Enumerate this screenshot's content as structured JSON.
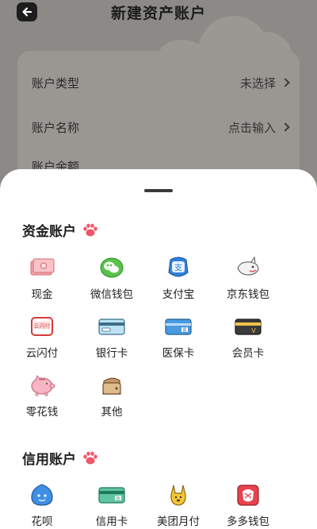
{
  "header": {
    "title": "新建资产账户"
  },
  "form": {
    "rows": [
      {
        "label": "账户类型",
        "value": "未选择"
      },
      {
        "label": "账户名称",
        "value": "点击输入"
      },
      {
        "label": "账户余额",
        "value": ""
      }
    ]
  },
  "sheet": {
    "sections": [
      {
        "title": "资金账户",
        "items": [
          {
            "label": "现金",
            "icon": "cash-icon"
          },
          {
            "label": "微信钱包",
            "icon": "wechat-wallet-icon"
          },
          {
            "label": "支付宝",
            "icon": "alipay-icon"
          },
          {
            "label": "京东钱包",
            "icon": "jd-wallet-icon"
          },
          {
            "label": "云闪付",
            "icon": "unionpay-quickpass-icon"
          },
          {
            "label": "银行卡",
            "icon": "bank-card-icon"
          },
          {
            "label": "医保卡",
            "icon": "medical-card-icon"
          },
          {
            "label": "会员卡",
            "icon": "member-card-icon"
          },
          {
            "label": "零花钱",
            "icon": "piggy-bank-icon"
          },
          {
            "label": "其他",
            "icon": "other-wallet-icon"
          }
        ]
      },
      {
        "title": "信用账户",
        "items": [
          {
            "label": "花呗",
            "icon": "huabei-icon"
          },
          {
            "label": "信用卡",
            "icon": "credit-card-icon"
          },
          {
            "label": "美团月付",
            "icon": "meituan-pay-icon"
          },
          {
            "label": "多多钱包",
            "icon": "duoduo-wallet-icon"
          }
        ]
      }
    ]
  },
  "colors": {
    "sheet_bg": "#ffffff",
    "overlay_bg": "#8c8a86",
    "paw": "#f0566a"
  }
}
